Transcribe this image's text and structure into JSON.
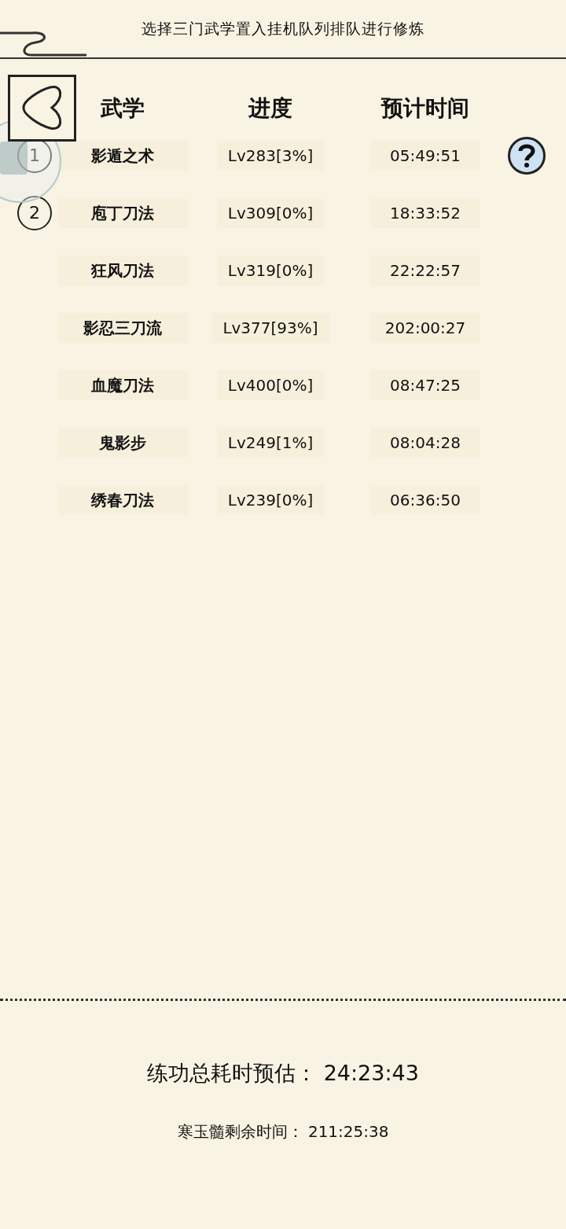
{
  "title": "选择三门武学置入挂机队列排队进行修炼",
  "columns": [
    "武学",
    "进度",
    "预计时间"
  ],
  "rows": [
    {
      "queue": "1",
      "name": "影遁之术",
      "progress": "Lv283[3%]",
      "time": "05:49:51"
    },
    {
      "queue": "2",
      "name": "庖丁刀法",
      "progress": "Lv309[0%]",
      "time": "18:33:52"
    },
    {
      "name": "狂风刀法",
      "progress": "Lv319[0%]",
      "time": "22:22:57"
    },
    {
      "name": "影忍三刀流",
      "progress": "Lv377[93%]",
      "time": "202:00:27"
    },
    {
      "name": "血魔刀法",
      "progress": "Lv400[0%]",
      "time": "08:47:25"
    },
    {
      "name": "鬼影步",
      "progress": "Lv249[1%]",
      "time": "08:04:28"
    },
    {
      "name": "绣春刀法",
      "progress": "Lv239[0%]",
      "time": "06:36:50"
    }
  ],
  "total": {
    "label": "练功总耗时预估：",
    "value": "24:23:43"
  },
  "remaining": {
    "label": "寒玉髓剩余时间：",
    "value": "211:25:38"
  }
}
